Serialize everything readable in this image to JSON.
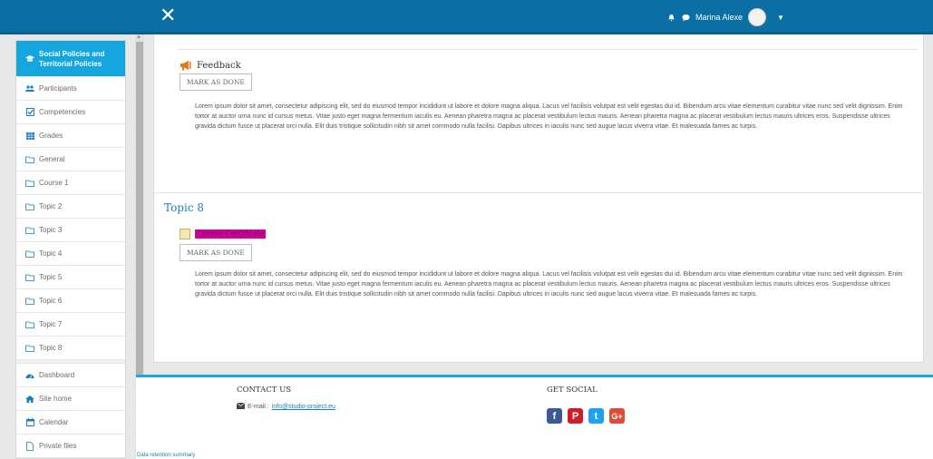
{
  "navbar": {
    "close_icon": "close-icon",
    "user_name": "Marina Alexe",
    "bell_icon": "bell-icon",
    "chat_icon": "chat-icon"
  },
  "sidebar": {
    "items": [
      {
        "label": "Social Policies and Territorial Policies",
        "icon": "graduation-cap-icon",
        "active": true
      },
      {
        "label": "Participants",
        "icon": "users-icon"
      },
      {
        "label": "Competencies",
        "icon": "checkbox-icon"
      },
      {
        "label": "Grades",
        "icon": "table-icon"
      },
      {
        "label": "General",
        "icon": "folder-icon"
      },
      {
        "label": "Course 1",
        "icon": "folder-icon"
      },
      {
        "label": "Topic 2",
        "icon": "folder-icon"
      },
      {
        "label": "Topic 3",
        "icon": "folder-icon"
      },
      {
        "label": "Topic 4",
        "icon": "folder-icon"
      },
      {
        "label": "Topic 5",
        "icon": "folder-icon"
      },
      {
        "label": "Topic 6",
        "icon": "folder-icon"
      },
      {
        "label": "Topic 7",
        "icon": "folder-icon"
      },
      {
        "label": "Topic 8",
        "icon": "folder-icon"
      }
    ],
    "items2": [
      {
        "label": "Dashboard",
        "icon": "dashboard-icon"
      },
      {
        "label": "Site home",
        "icon": "home-icon"
      },
      {
        "label": "Calendar",
        "icon": "calendar-icon"
      },
      {
        "label": "Private files",
        "icon": "file-icon"
      }
    ]
  },
  "main": {
    "feedback": {
      "title": "Feedback",
      "mark_label": "MARK AS DONE",
      "text": "Lorem ipsum dolor sit amet, consectetur adipiscing elit, sed do eiusmod tempor incididunt ut labore et dolore magna aliqua. Lacus vel facilisis volutpat est velit egestas dui id. Bibendum arcu vitae elementum curabitur vitae nunc sed velit dignissim. Enim tortor at auctor urna nunc id cursus metus. Vitae justo eget magna fermentum iaculis eu. Aenean pharetra magna ac placerat vestibulum lectus mauris. Aenean pharetra magna ac placerat vestibulum lectus mauris ultrices eros. Suspendisse ultrices gravida dictum fusce ut placerat orci nulla. Elit duis tristique sollicitudin nibh sit amet commodo nulla facilisi. Dapibus ultrices in iaculis nunc sed augue lacus viverra vitae. Et malesuada fames ac turpis."
    },
    "topic8": {
      "title": "Topic 8",
      "certificate_label": "Course Certificate",
      "mark_label": "MARK AS DONE",
      "text": "Lorem ipsum dolor sit amet, consectetur adipiscing elit, sed do eiusmod tempor incididunt ut labore et dolore magna aliqua. Lacus vel facilisis volutpat est velit egestas dui id. Bibendum arcu vitae elementum curabitur vitae nunc sed velit dignissim. Enim tortor at auctor urna nunc id cursus metus. Vitae justo eget magna fermentum iaculis eu. Aenean pharetra magna ac placerat vestibulum lectus mauris. Aenean pharetra magna ac placerat vestibulum lectus mauris ultrices eros. Suspendisse ultrices gravida dictum fusce ut placerat orci nulla. Elit duis tristique sollicitudin nibh sit amet commodo nulla facilisi. Dapibus ultrices in iaculis nunc sed augue lacus viverra vitae. Et malesuada fames ac turpis."
    }
  },
  "footer": {
    "contact_heading": "CONTACT US",
    "email_prefix": "E-mail :",
    "email": "info@studio-project.eu",
    "social_heading": "GET SOCIAL",
    "socials": [
      {
        "glyph": "f",
        "name": "facebook-icon",
        "color": "#3b5998"
      },
      {
        "glyph": "P",
        "name": "pinterest-icon",
        "color": "#cb2027"
      },
      {
        "glyph": "t",
        "name": "twitter-icon",
        "color": "#1da1f2"
      },
      {
        "glyph": "G+",
        "name": "google-plus-icon",
        "color": "#dd4b39"
      }
    ],
    "retention_link": "Data retention summary"
  },
  "colors": {
    "navbar": "#0b6fa4",
    "accent": "#14a6dc",
    "link": "#1a7fb8",
    "highlight": "#d1009a"
  }
}
